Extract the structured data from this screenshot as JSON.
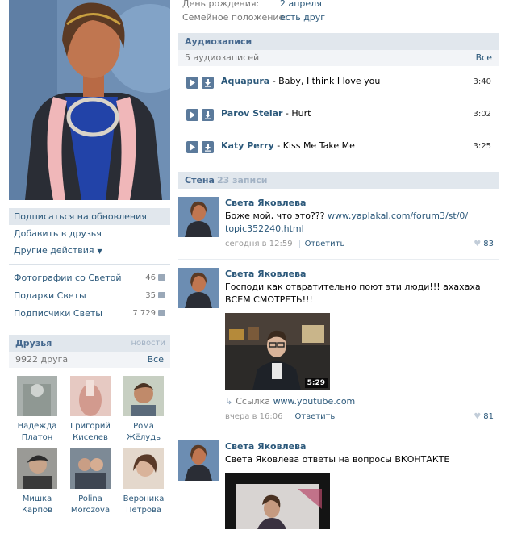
{
  "profile": {
    "birthday_label": "День рождения:",
    "birthday_value": "2 апреля",
    "family_label": "Семейное положение:",
    "family_value": "есть друг"
  },
  "left_menu": {
    "subscribe": "Подписаться на обновления",
    "add_friend": "Добавить в друзья",
    "other": "Другие действия"
  },
  "stats": [
    {
      "label": "Фотографии со Светой",
      "count": "46"
    },
    {
      "label": "Подарки Светы",
      "count": "35"
    },
    {
      "label": "Подписчики Светы",
      "count": "7 729"
    }
  ],
  "friends": {
    "title": "Друзья",
    "news": "новости",
    "count": "9922 друга",
    "all": "Все",
    "items": [
      {
        "first": "Надежда",
        "last": "Платон"
      },
      {
        "first": "Григорий",
        "last": "Киселев"
      },
      {
        "first": "Рома",
        "last": "Жёлудь"
      },
      {
        "first": "Мишка",
        "last": "Карпов"
      },
      {
        "first": "Polina",
        "last": "Morozova"
      },
      {
        "first": "Вероника",
        "last": "Петрова"
      }
    ]
  },
  "audio": {
    "title": "Аудиозаписи",
    "count": "5 аудиозаписей",
    "all": "Все",
    "tracks": [
      {
        "artist": "Aquapura",
        "title": " - Baby, I think I love you",
        "duration": "3:40"
      },
      {
        "artist": "Parov Stelar",
        "title": " - Hurt",
        "duration": "3:02"
      },
      {
        "artist": "Katy Perry",
        "title": " - Kiss Me Take Me",
        "duration": "3:25"
      }
    ]
  },
  "wall": {
    "title": "Стена",
    "count": "23 записи",
    "posts": [
      {
        "author": "Света Яковлева",
        "text_before": "Боже мой, что это??? ",
        "link": "www.yaplakal.com/forum3/st/0/ topic352240.html",
        "time": "сегодня в 12:59",
        "reply": "Ответить",
        "likes": "83"
      },
      {
        "author": "Света Яковлева",
        "text": "Господи как отвратительно поют эти люди!!! ахахаха ВСЕМ СМОТРЕТЬ!!!",
        "video_duration": "5:29",
        "attach_label": "Ссылка",
        "attach_link": "www.youtube.com",
        "time": "вчера в 16:06",
        "reply": "Ответить",
        "likes": "81"
      },
      {
        "author": "Света Яковлева",
        "text": "Света Яковлева ответы на вопросы ВКОНТАКТЕ"
      }
    ]
  }
}
